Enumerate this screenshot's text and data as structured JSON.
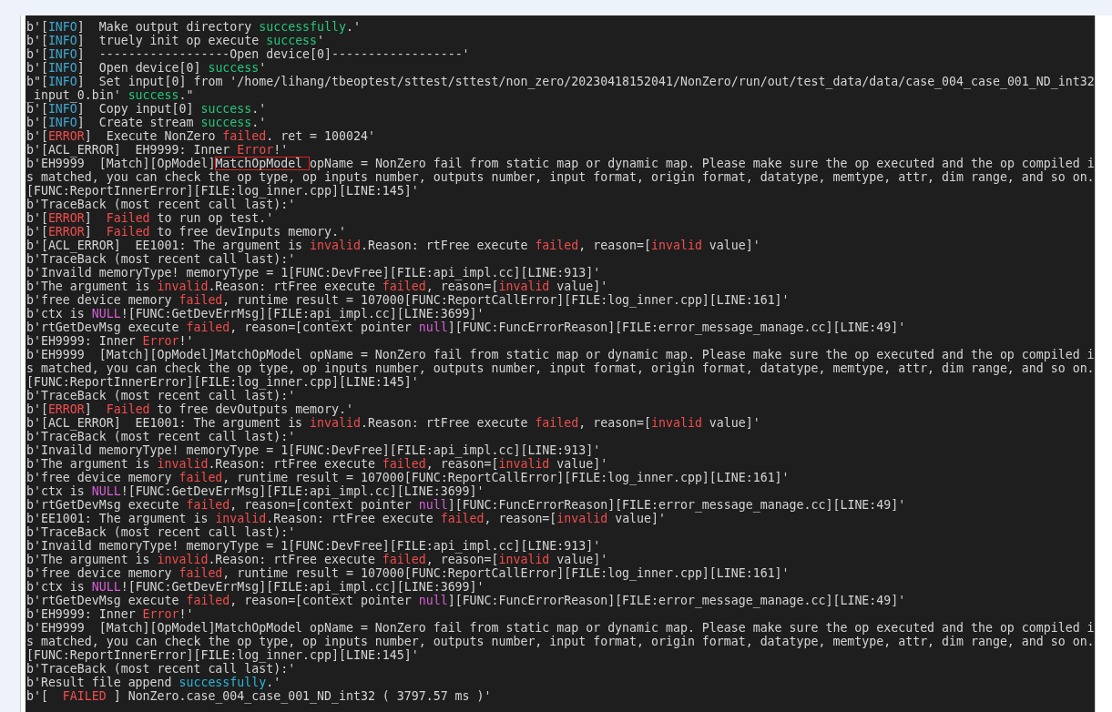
{
  "log_lines": [
    [
      {
        "text": "b'[",
        "kind": "plain"
      },
      {
        "text": "INFO",
        "kind": "info"
      },
      {
        "text": "]  Make output directory ",
        "kind": "plain"
      },
      {
        "text": "successfully",
        "kind": "ok"
      },
      {
        "text": ".'",
        "kind": "plain"
      }
    ],
    [
      {
        "text": "b'[",
        "kind": "plain"
      },
      {
        "text": "INFO",
        "kind": "info"
      },
      {
        "text": "]  truely init op execute ",
        "kind": "plain"
      },
      {
        "text": "success",
        "kind": "ok"
      },
      {
        "text": "'",
        "kind": "plain"
      }
    ],
    [
      {
        "text": "b'[",
        "kind": "plain"
      },
      {
        "text": "INFO",
        "kind": "info"
      },
      {
        "text": "]  ------------------Open device[0]------------------'",
        "kind": "plain"
      }
    ],
    [
      {
        "text": "b'[",
        "kind": "plain"
      },
      {
        "text": "INFO",
        "kind": "info"
      },
      {
        "text": "]  Open device[0] ",
        "kind": "plain"
      },
      {
        "text": "success",
        "kind": "ok"
      },
      {
        "text": "'",
        "kind": "plain"
      }
    ],
    [
      {
        "text": "b\"[",
        "kind": "plain"
      },
      {
        "text": "INFO",
        "kind": "info"
      },
      {
        "text": "]  Set input[0] from '/home/lihang/tbeoptest/sttest/sttest/non_zero/20230418152041/NonZero/run/out/test_data/data/case_004_case_001_ND_int32",
        "kind": "plain"
      }
    ],
    [
      {
        "text": "_input_0.bin' ",
        "kind": "plain"
      },
      {
        "text": "success",
        "kind": "ok"
      },
      {
        "text": ".\"",
        "kind": "plain"
      }
    ],
    [
      {
        "text": "b'[",
        "kind": "plain"
      },
      {
        "text": "INFO",
        "kind": "info"
      },
      {
        "text": "]  Copy input[0] ",
        "kind": "plain"
      },
      {
        "text": "success",
        "kind": "ok"
      },
      {
        "text": ".'",
        "kind": "plain"
      }
    ],
    [
      {
        "text": "b'[",
        "kind": "plain"
      },
      {
        "text": "INFO",
        "kind": "info"
      },
      {
        "text": "]  Create stream ",
        "kind": "plain"
      },
      {
        "text": "success",
        "kind": "ok"
      },
      {
        "text": ".'",
        "kind": "plain"
      }
    ],
    [
      {
        "text": "b'[",
        "kind": "plain"
      },
      {
        "text": "ERROR",
        "kind": "err"
      },
      {
        "text": "]  Execute NonZero ",
        "kind": "plain"
      },
      {
        "text": "failed",
        "kind": "err"
      },
      {
        "text": ". ret = 100024'",
        "kind": "plain"
      }
    ],
    [
      {
        "text": "b'[ACL_ERROR]  EH9999: Inner ",
        "kind": "plain"
      },
      {
        "text": "Error",
        "kind": "err"
      },
      {
        "text": "!'",
        "kind": "plain"
      }
    ],
    [
      {
        "text": "b'EH9999  [Match][OpModel]",
        "kind": "plain"
      },
      {
        "text": "MatchOpModel ",
        "kind": "boxed"
      },
      {
        "text": "opName = NonZero fail from static map or dynamic map. Please make sure the op executed and the op compiled i",
        "kind": "plain"
      }
    ],
    [
      {
        "text": "s matched, you can check the op type, op inputs number, outputs number, input format, origin format, datatype, memtype, attr, dim range, and so on.",
        "kind": "plain"
      }
    ],
    [
      {
        "text": "[FUNC:ReportInnerError][FILE:log_inner.cpp][LINE:145]'",
        "kind": "plain"
      }
    ],
    [
      {
        "text": "b'TraceBack (most recent call last):'",
        "kind": "plain"
      }
    ],
    [
      {
        "text": "b'[",
        "kind": "plain"
      },
      {
        "text": "ERROR",
        "kind": "err"
      },
      {
        "text": "]  ",
        "kind": "plain"
      },
      {
        "text": "Failed",
        "kind": "err"
      },
      {
        "text": " to run op test.'",
        "kind": "plain"
      }
    ],
    [
      {
        "text": "b'[",
        "kind": "plain"
      },
      {
        "text": "ERROR",
        "kind": "err"
      },
      {
        "text": "]  ",
        "kind": "plain"
      },
      {
        "text": "Failed",
        "kind": "err"
      },
      {
        "text": " to free devInputs memory.'",
        "kind": "plain"
      }
    ],
    [
      {
        "text": "b'[ACL_ERROR]  EE1001: The argument is ",
        "kind": "plain"
      },
      {
        "text": "invalid",
        "kind": "err"
      },
      {
        "text": ".Reason: rtFree execute ",
        "kind": "plain"
      },
      {
        "text": "failed",
        "kind": "err"
      },
      {
        "text": ", reason=[",
        "kind": "plain"
      },
      {
        "text": "invalid",
        "kind": "err"
      },
      {
        "text": " value]'",
        "kind": "plain"
      }
    ],
    [
      {
        "text": "b'TraceBack (most recent call last):'",
        "kind": "plain"
      }
    ],
    [
      {
        "text": "b'Invaild memoryType! memoryType = 1[FUNC:DevFree][FILE:api_impl.cc][LINE:913]'",
        "kind": "plain"
      }
    ],
    [
      {
        "text": "b'The argument is ",
        "kind": "plain"
      },
      {
        "text": "invalid",
        "kind": "err"
      },
      {
        "text": ".Reason: rtFree execute ",
        "kind": "plain"
      },
      {
        "text": "failed",
        "kind": "err"
      },
      {
        "text": ", reason=[",
        "kind": "plain"
      },
      {
        "text": "invalid",
        "kind": "err"
      },
      {
        "text": " value]'",
        "kind": "plain"
      }
    ],
    [
      {
        "text": "b'free device memory ",
        "kind": "plain"
      },
      {
        "text": "failed",
        "kind": "err"
      },
      {
        "text": ", runtime result = 107000[FUNC:ReportCallError][FILE:log_inner.cpp][LINE:161]'",
        "kind": "plain"
      }
    ],
    [
      {
        "text": "b'ctx is ",
        "kind": "plain"
      },
      {
        "text": "NULL",
        "kind": "null"
      },
      {
        "text": "![FUNC:GetDevErrMsg][FILE:api_impl.cc][LINE:3699]'",
        "kind": "plain"
      }
    ],
    [
      {
        "text": "b'rtGetDevMsg execute ",
        "kind": "plain"
      },
      {
        "text": "failed",
        "kind": "err"
      },
      {
        "text": ", reason=[context pointer ",
        "kind": "plain"
      },
      {
        "text": "null",
        "kind": "null"
      },
      {
        "text": "][FUNC:FuncErrorReason][FILE:error_message_manage.cc][LINE:49]'",
        "kind": "plain"
      }
    ],
    [
      {
        "text": "b'EH9999: Inner ",
        "kind": "plain"
      },
      {
        "text": "Error",
        "kind": "err"
      },
      {
        "text": "!'",
        "kind": "plain"
      }
    ],
    [
      {
        "text": "b'EH9999  [Match][OpModel]MatchOpModel opName = NonZero fail from static map or dynamic map. Please make sure the op executed and the op compiled i",
        "kind": "plain"
      }
    ],
    [
      {
        "text": "s matched, you can check the op type, op inputs number, outputs number, input format, origin format, datatype, memtype, attr, dim range, and so on.",
        "kind": "plain"
      }
    ],
    [
      {
        "text": "[FUNC:ReportInnerError][FILE:log_inner.cpp][LINE:145]'",
        "kind": "plain"
      }
    ],
    [
      {
        "text": "b'TraceBack (most recent call last):'",
        "kind": "plain"
      }
    ],
    [
      {
        "text": "b'[",
        "kind": "plain"
      },
      {
        "text": "ERROR",
        "kind": "err"
      },
      {
        "text": "]  ",
        "kind": "plain"
      },
      {
        "text": "Failed",
        "kind": "err"
      },
      {
        "text": " to free devOutputs memory.'",
        "kind": "plain"
      }
    ],
    [
      {
        "text": "b'[ACL_ERROR]  EE1001: The argument is ",
        "kind": "plain"
      },
      {
        "text": "invalid",
        "kind": "err"
      },
      {
        "text": ".Reason: rtFree execute ",
        "kind": "plain"
      },
      {
        "text": "failed",
        "kind": "err"
      },
      {
        "text": ", reason=[",
        "kind": "plain"
      },
      {
        "text": "invalid",
        "kind": "err"
      },
      {
        "text": " value]'",
        "kind": "plain"
      }
    ],
    [
      {
        "text": "b'TraceBack (most recent call last):'",
        "kind": "plain"
      }
    ],
    [
      {
        "text": "b'Invaild memoryType! memoryType = 1[FUNC:DevFree][FILE:api_impl.cc][LINE:913]'",
        "kind": "plain"
      }
    ],
    [
      {
        "text": "b'The argument is ",
        "kind": "plain"
      },
      {
        "text": "invalid",
        "kind": "err"
      },
      {
        "text": ".Reason: rtFree execute ",
        "kind": "plain"
      },
      {
        "text": "failed",
        "kind": "err"
      },
      {
        "text": ", reason=[",
        "kind": "plain"
      },
      {
        "text": "invalid",
        "kind": "err"
      },
      {
        "text": " value]'",
        "kind": "plain"
      }
    ],
    [
      {
        "text": "b'free device memory ",
        "kind": "plain"
      },
      {
        "text": "failed",
        "kind": "err"
      },
      {
        "text": ", runtime result = 107000[FUNC:ReportCallError][FILE:log_inner.cpp][LINE:161]'",
        "kind": "plain"
      }
    ],
    [
      {
        "text": "b'ctx is ",
        "kind": "plain"
      },
      {
        "text": "NULL",
        "kind": "null"
      },
      {
        "text": "![FUNC:GetDevErrMsg][FILE:api_impl.cc][LINE:3699]'",
        "kind": "plain"
      }
    ],
    [
      {
        "text": "b'rtGetDevMsg execute ",
        "kind": "plain"
      },
      {
        "text": "failed",
        "kind": "err"
      },
      {
        "text": ", reason=[context pointer ",
        "kind": "plain"
      },
      {
        "text": "null",
        "kind": "null"
      },
      {
        "text": "][FUNC:FuncErrorReason][FILE:error_message_manage.cc][LINE:49]'",
        "kind": "plain"
      }
    ],
    [
      {
        "text": "b'EE1001: The argument is ",
        "kind": "plain"
      },
      {
        "text": "invalid",
        "kind": "err"
      },
      {
        "text": ".Reason: rtFree execute ",
        "kind": "plain"
      },
      {
        "text": "failed",
        "kind": "err"
      },
      {
        "text": ", reason=[",
        "kind": "plain"
      },
      {
        "text": "invalid",
        "kind": "err"
      },
      {
        "text": " value]'",
        "kind": "plain"
      }
    ],
    [
      {
        "text": "b'TraceBack (most recent call last):'",
        "kind": "plain"
      }
    ],
    [
      {
        "text": "b'Invaild memoryType! memoryType = 1[FUNC:DevFree][FILE:api_impl.cc][LINE:913]'",
        "kind": "plain"
      }
    ],
    [
      {
        "text": "b'The argument is ",
        "kind": "plain"
      },
      {
        "text": "invalid",
        "kind": "err"
      },
      {
        "text": ".Reason: rtFree execute ",
        "kind": "plain"
      },
      {
        "text": "failed",
        "kind": "err"
      },
      {
        "text": ", reason=[",
        "kind": "plain"
      },
      {
        "text": "invalid",
        "kind": "err"
      },
      {
        "text": " value]'",
        "kind": "plain"
      }
    ],
    [
      {
        "text": "b'free device memory ",
        "kind": "plain"
      },
      {
        "text": "failed",
        "kind": "err"
      },
      {
        "text": ", runtime result = 107000[FUNC:ReportCallError][FILE:log_inner.cpp][LINE:161]'",
        "kind": "plain"
      }
    ],
    [
      {
        "text": "b'ctx is ",
        "kind": "plain"
      },
      {
        "text": "NULL",
        "kind": "null"
      },
      {
        "text": "![FUNC:GetDevErrMsg][FILE:api_impl.cc][LINE:3699]'",
        "kind": "plain"
      }
    ],
    [
      {
        "text": "b'rtGetDevMsg execute ",
        "kind": "plain"
      },
      {
        "text": "failed",
        "kind": "err"
      },
      {
        "text": ", reason=[context pointer ",
        "kind": "plain"
      },
      {
        "text": "null",
        "kind": "null"
      },
      {
        "text": "][FUNC:FuncErrorReason][FILE:error_message_manage.cc][LINE:49]'",
        "kind": "plain"
      }
    ],
    [
      {
        "text": "b'EH9999: Inner ",
        "kind": "plain"
      },
      {
        "text": "Error",
        "kind": "err"
      },
      {
        "text": "!'",
        "kind": "plain"
      }
    ],
    [
      {
        "text": "b'EH9999  [Match][OpModel]MatchOpModel opName = NonZero fail from static map or dynamic map. Please make sure the op executed and the op compiled i",
        "kind": "plain"
      }
    ],
    [
      {
        "text": "s matched, you can check the op type, op inputs number, outputs number, input format, origin format, datatype, memtype, attr, dim range, and so on.",
        "kind": "plain"
      }
    ],
    [
      {
        "text": "[FUNC:ReportInnerError][FILE:log_inner.cpp][LINE:145]'",
        "kind": "plain"
      }
    ],
    [
      {
        "text": "b'TraceBack (most recent call last):'",
        "kind": "plain"
      }
    ],
    [
      {
        "text": "b'Result file append ",
        "kind": "plain"
      },
      {
        "text": "successfully",
        "kind": "note"
      },
      {
        "text": ".'",
        "kind": "plain"
      }
    ],
    [
      {
        "text": "b'[  ",
        "kind": "plain"
      },
      {
        "text": "FAILED",
        "kind": "err"
      },
      {
        "text": " ] NonZero.case_004_case_001_ND_int32 ( 3797.57 ms )'",
        "kind": "plain"
      }
    ]
  ]
}
